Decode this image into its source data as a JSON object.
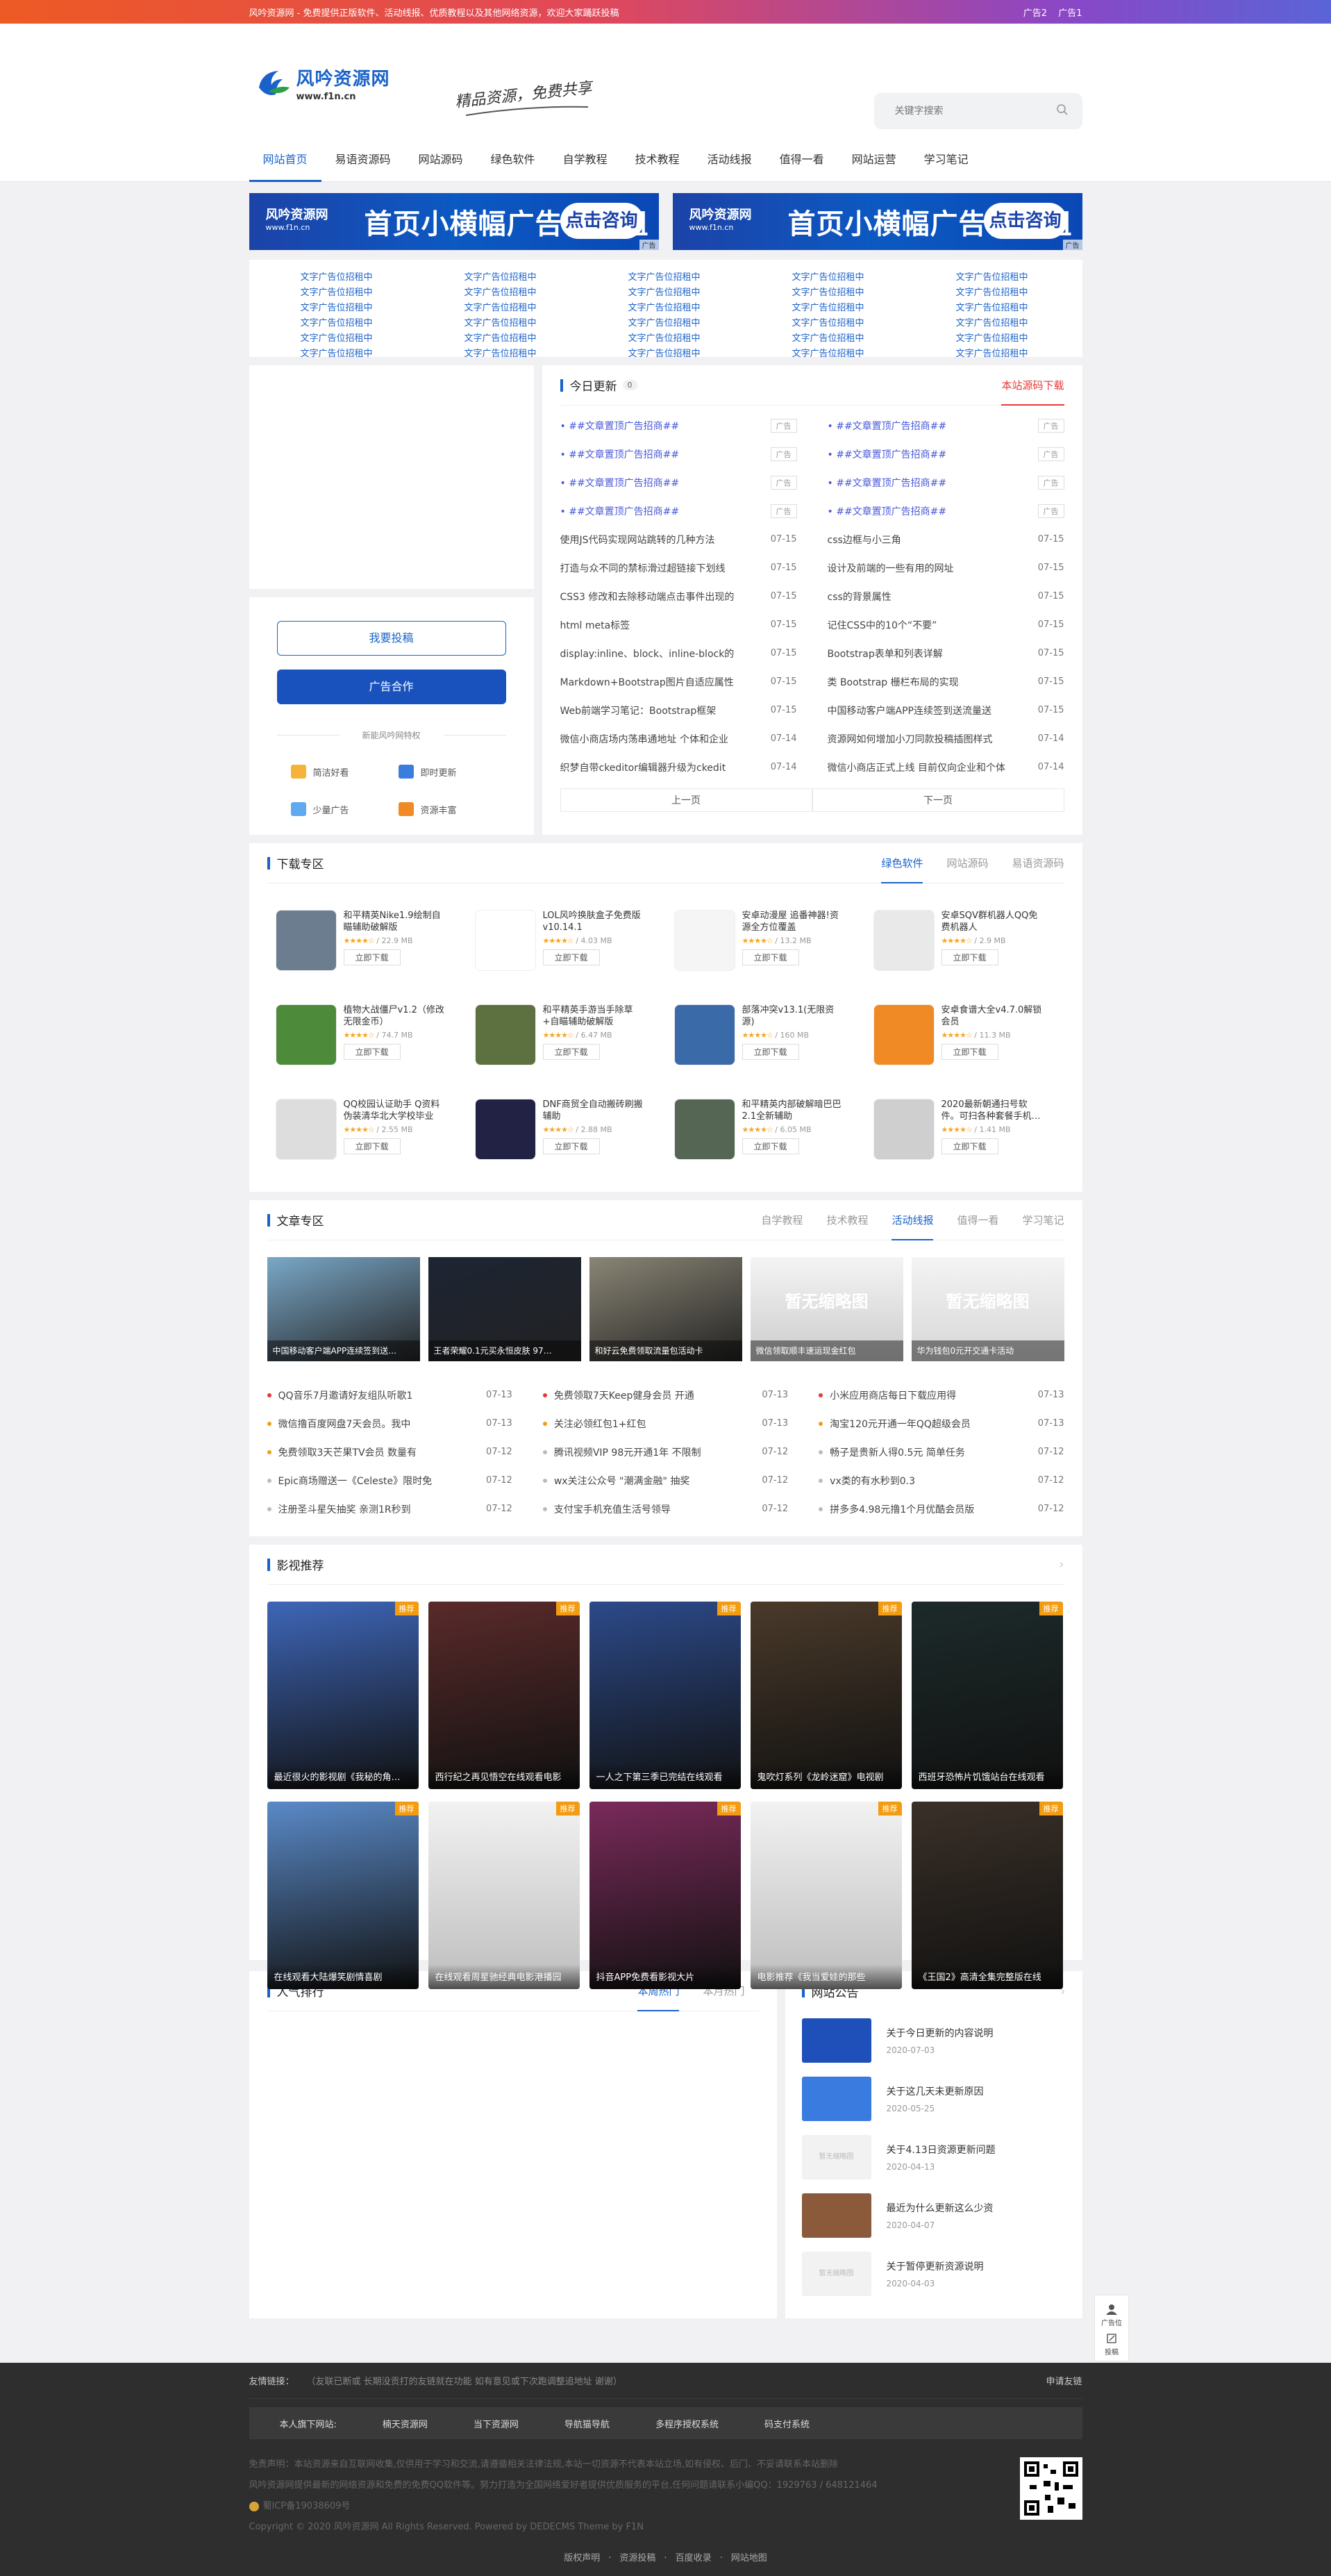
{
  "topbar": {
    "notice": "风吟资源网 - 免费提供正版软件、活动线报、优质教程以及其他网络资源，欢迎大家踊跃投稿",
    "ad2": "广告2",
    "ad1": "广告1"
  },
  "header": {
    "logo_cn": "风吟资源网",
    "logo_url": "www.f1n.cn",
    "slogan": "精品资源，免费共享",
    "search_placeholder": "关键字搜索"
  },
  "nav": [
    "网站首页",
    "易语资源码",
    "网站源码",
    "绿色软件",
    "自学教程",
    "技术教程",
    "活动线报",
    "值得一看",
    "网站运营",
    "学习笔记"
  ],
  "banner": {
    "logo": "风吟资源网",
    "logo_url": "www.f1n.cn",
    "text": "首页小横幅广告位招租",
    "button": "点击咨询",
    "tag": "广告"
  },
  "text_ad": "文字广告位招租中",
  "sidebar": {
    "submit": "我要投稿",
    "ad_coop": "广告合作",
    "divider": "新能风吟网特权",
    "features": [
      "简洁好看",
      "即时更新",
      "少量广告",
      "资源丰富"
    ]
  },
  "updates": {
    "title": "今日更新",
    "count": "0",
    "download_link": "本站源码下载",
    "ad_text": "##文章置顶广告招商##",
    "ad_tag": "广告",
    "left": [
      [
        "使用JS代码实现网站跳转的几种方法",
        "07-15"
      ],
      [
        "打造与众不同的禁标滑过超链接下划线",
        "07-15"
      ],
      [
        "CSS3 修改和去除移动端点击事件出现的",
        "07-15"
      ],
      [
        "html meta标签",
        "07-15"
      ],
      [
        "display:inline、block、inline-block的",
        "07-15"
      ],
      [
        "Markdown+Bootstrap图片自适应属性",
        "07-15"
      ],
      [
        "Web前端学习笔记：Bootstrap框架",
        "07-15"
      ],
      [
        "微信小商店场内荡串通地址 个体和企业",
        "07-14"
      ],
      [
        "织梦自带ckeditor编辑器升级为ckedit",
        "07-14"
      ]
    ],
    "right": [
      [
        "css边框与小三角",
        "07-15"
      ],
      [
        "设计及前端的一些有用的网址",
        "07-15"
      ],
      [
        "css的背景属性",
        "07-15"
      ],
      [
        "记住CSS中的10个“不要”",
        "07-15"
      ],
      [
        "Bootstrap表单和列表详解",
        "07-15"
      ],
      [
        "类 Bootstrap 栅栏布局的实现",
        "07-15"
      ],
      [
        "中国移动客户端APP连续签到送流量送",
        "07-15"
      ],
      [
        "资源网如何增加小刀同款投稿插图样式",
        "07-14"
      ],
      [
        "微信小商店正式上线 目前仅向企业和个体",
        "07-14"
      ]
    ],
    "prev": "上一页",
    "next": "下一页"
  },
  "download": {
    "title": "下载专区",
    "tabs": [
      "绿色软件",
      "网站源码",
      "易语资源码"
    ],
    "btn": "立即下载",
    "items": [
      {
        "name": "和平精英Nike1.9绘制自瞄辅助破解版",
        "size": "22.9 MB",
        "color": "#6b7d8f"
      },
      {
        "name": "LOL风吟换肤盒子免费版v10.14.1",
        "size": "4.03 MB",
        "color": "#ffffff"
      },
      {
        "name": "安卓动漫屋 追番神器!资源全方位覆盖",
        "size": "13.2 MB",
        "color": "#f5f5f5"
      },
      {
        "name": "安卓SQV群机器人QQ免费机器人",
        "size": "2.9 MB",
        "color": "#e9e9e9"
      },
      {
        "name": "植物大战僵尸v1.2（修改无限金币）",
        "size": "74.7 MB",
        "color": "#4d8a3a"
      },
      {
        "name": "和平精英手游当手除草+自瞄辅助破解版",
        "size": "6.47 MB",
        "color": "#5d7040"
      },
      {
        "name": "部落冲突v13.1(无限资源)",
        "size": "160 MB",
        "color": "#3a6aa8"
      },
      {
        "name": "安卓食谱大全v4.7.0解锁会员",
        "size": "11.3 MB",
        "color": "#f08a24"
      },
      {
        "name": "QQ校园认证助手 Q资料伪装清华北大学校毕业",
        "size": "2.55 MB",
        "color": "#dddddd"
      },
      {
        "name": "DNF商贸全自动搬砖刷搬辅助",
        "size": "2.88 MB",
        "color": "#222244"
      },
      {
        "name": "和平精英内部破解暗巴巴2.1全新辅助",
        "size": "6.05 MB",
        "color": "#556655"
      },
      {
        "name": "2020最新朝通扫号软件。可扫各种套餐手机…",
        "size": "1.41 MB",
        "color": "#cfcfcf"
      }
    ]
  },
  "articles": {
    "title": "文章专区",
    "tabs": [
      "自学教程",
      "技术教程",
      "活动线报",
      "值得一看",
      "学习笔记"
    ],
    "thumbs": [
      {
        "cap": "中国移动客户端APP连续签到送…",
        "color": "#7aa8c8"
      },
      {
        "cap": "王者荣耀0.1元买永恒皮肤 97…",
        "color": "#1d2433"
      },
      {
        "cap": "和好云免费领取流量包活动卡",
        "color": "#8a8575"
      },
      {
        "cap": "微信领取顺丰速运现金红包",
        "color": "#cccccc"
      },
      {
        "cap": "华为钱包0元开交通卡活动",
        "color": "#d6d6d6"
      }
    ],
    "no_thumb": "暂无缩略图",
    "list": [
      [
        [
          "QQ音乐7月邀请好友组队听歌1",
          "07-13",
          "#e53935"
        ],
        [
          "免费领取7天Keep健身会员 开通",
          "07-13",
          "#e53935"
        ],
        [
          "小米应用商店每日下载应用得",
          "07-13",
          "#e53935"
        ]
      ],
      [
        [
          "微信撸百度网盘7天会员。我中",
          "07-13",
          "#f39c12"
        ],
        [
          "关注必领红包1+红包",
          "07-13",
          "#f39c12"
        ],
        [
          "淘宝120元开通一年QQ超级会员",
          "07-13",
          "#f39c12"
        ]
      ],
      [
        [
          "免费领取3天芒果TV会员 数量有",
          "07-12",
          "#f39c12"
        ],
        [
          "腾讯视频VIP 98元开通1年 不限制",
          "07-12",
          "#bbbbbb"
        ],
        [
          "畅子是贵新人得0.5元 简单任务",
          "07-12",
          "#bbbbbb"
        ]
      ],
      [
        [
          "Epic商场赠送一《Celeste》限时免",
          "07-12",
          "#bbbbbb"
        ],
        [
          "wx关注公众号 \"潮满金融\" 抽奖",
          "07-12",
          "#bbbbbb"
        ],
        [
          "vx类的有水秒到0.3",
          "07-12",
          "#bbbbbb"
        ]
      ],
      [
        [
          "注册圣斗星矢抽奖 亲测1R秒到",
          "07-12",
          "#bbbbbb"
        ],
        [
          "支付宝手机充值生活号领导",
          "07-12",
          "#bbbbbb"
        ],
        [
          "拼多多4.98元撸1个月优酷会员版",
          "07-12",
          "#bbbbbb"
        ]
      ]
    ]
  },
  "movies": {
    "title": "影视推荐",
    "badge": "推荐",
    "items": [
      {
        "cap": "最近很火的影视剧《我秘的角…",
        "color": "#3e66b8"
      },
      {
        "cap": "西行纪之再见悟空在线观看电影",
        "color": "#5a2a2a"
      },
      {
        "cap": "一人之下第三季已完结在线观看",
        "color": "#2c4a8a"
      },
      {
        "cap": "鬼吹灯系列《龙岭迷窟》电视剧",
        "color": "#4a3a2a"
      },
      {
        "cap": "西班牙恐怖片饥饿站台在线观看",
        "color": "#1d2a2a"
      },
      {
        "cap": "在线观看大陆爆笑剧情喜剧",
        "color": "#5a8ac8"
      },
      {
        "cap": "在线观看周星驰经典电影港播园",
        "color": "#d0d0d0"
      },
      {
        "cap": "抖音APP免费看影视大片",
        "color": "#7a2a5a"
      },
      {
        "cap": "电影推荐《我当爱娃的那些",
        "color": "#cfcfcf"
      },
      {
        "cap": "《王国2》高清全集完整版在线",
        "color": "#3a3028"
      }
    ]
  },
  "hot": {
    "title": "人气排行",
    "tabs": [
      "本周热门",
      "本月热门"
    ]
  },
  "notice": {
    "title": "网站公告",
    "items": [
      {
        "t": "关于今日更新的内容说明",
        "d": "2020-07-03",
        "color": "#1f4fb8"
      },
      {
        "t": "关于这几天未更新原因",
        "d": "2020-05-25",
        "color": "#3a7be0"
      },
      {
        "t": "关于4.13日资源更新问题",
        "d": "2020-04-13",
        "color": "#f2f2f2"
      },
      {
        "t": "最近为什么更新这么少资",
        "d": "2020-04-07",
        "color": "#8a5a3a"
      },
      {
        "t": "关于暂停更新资源说明",
        "d": "2020-04-03",
        "color": "#f2f2f2"
      }
    ],
    "no_thumb": "暂无缩略图"
  },
  "side_fixed": {
    "ad": "广告位",
    "submit": "投稿"
  },
  "footer": {
    "links_label": "友情链接：",
    "links_note": "（友联已断或 长期没贡打的友链就在功能 如有意见或下次跑调整追地址 谢谢）",
    "apply": "申请友链",
    "sites": [
      "本人旗下网站:",
      "楠天资源网",
      "当下资源网",
      "导航猫导航",
      "多程序授权系统",
      "码支付系统"
    ],
    "disclaimer": "免责声明：本站资源来自互联网收集,仅供用于学习和交流,请遵循相关法律法规,本站一切资源不代表本站立场,如有侵权、后门、不妥请联系本站删除",
    "desc": "风吟资源网提供最新的网络资源和免费的免费QQ软件等。努力打造为全国网络爱好者提供优质服务的平台,任何问题请联系小编QQ：1929763 / 648121464",
    "icp": "蜀ICP备19038609号",
    "copyright": "Copyright © 2020 风吟资源网 All Rights Reserved. Powered by DEDECMS Theme by F1N",
    "bottom_links": [
      "版权声明",
      "资源投稿",
      "百度收录",
      "网站地图"
    ]
  }
}
